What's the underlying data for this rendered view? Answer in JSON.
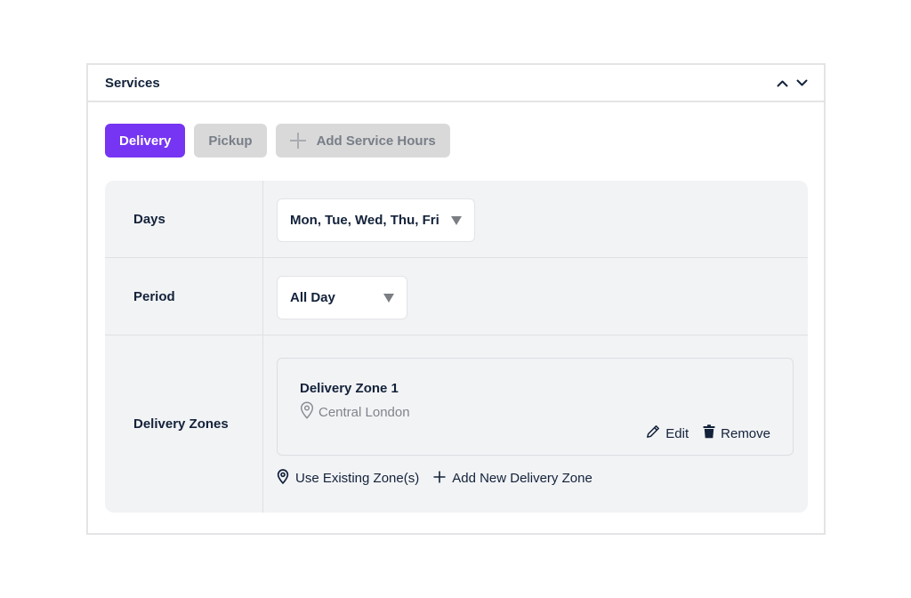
{
  "card": {
    "title": "Services",
    "collapse_icon": "chevron-up-icon",
    "expand_icon": "chevron-down-icon"
  },
  "tabs": [
    {
      "label": "Delivery",
      "active": true
    },
    {
      "label": "Pickup",
      "active": false
    },
    {
      "label": "Add Service Hours",
      "icon": "plus-icon",
      "active": false
    }
  ],
  "colors": {
    "accent": "#7535f2",
    "inactive_tab": "#d9d9d9",
    "panel_bg": "#f2f3f5",
    "text_primary": "#13223a",
    "text_muted": "#7f848b"
  },
  "rows": {
    "days": {
      "label": "Days",
      "value": "Mon, Tue, Wed, Thu, Fri"
    },
    "period": {
      "label": "Period",
      "value": "All Day"
    },
    "zones": {
      "label": "Delivery Zones",
      "items": [
        {
          "name": "Delivery Zone 1",
          "location": "Central London",
          "edit_label": "Edit",
          "remove_label": "Remove"
        }
      ],
      "use_existing_label": "Use Existing Zone(s)",
      "add_new_label": "Add New Delivery Zone"
    }
  }
}
